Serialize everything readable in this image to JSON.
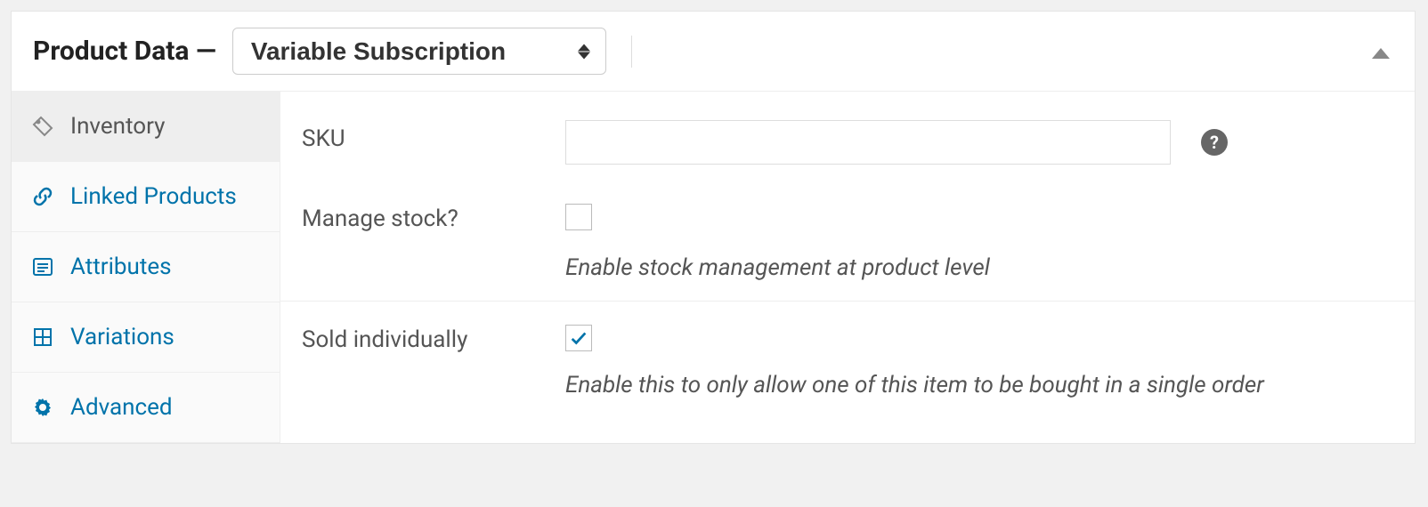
{
  "header": {
    "title": "Product Data —",
    "product_type": "Variable Subscription"
  },
  "tabs": [
    {
      "label": "Inventory",
      "icon": "tag-icon"
    },
    {
      "label": "Linked Products",
      "icon": "link-icon"
    },
    {
      "label": "Attributes",
      "icon": "list-icon"
    },
    {
      "label": "Variations",
      "icon": "grid-icon"
    },
    {
      "label": "Advanced",
      "icon": "gear-icon"
    }
  ],
  "fields": {
    "sku": {
      "label": "SKU",
      "value": ""
    },
    "manage_stock": {
      "label": "Manage stock?",
      "checked": false,
      "description": "Enable stock management at product level"
    },
    "sold_individually": {
      "label": "Sold individually",
      "checked": true,
      "description": "Enable this to only allow one of this item to be bought in a single order"
    }
  },
  "help_tooltip": "?"
}
